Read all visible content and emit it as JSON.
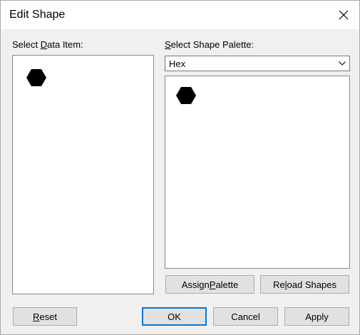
{
  "window": {
    "title": "Edit Shape",
    "close_icon": "close-icon"
  },
  "left_panel": {
    "label_prefix": "Select ",
    "label_mnemonic": "D",
    "label_suffix": "ata Item:",
    "items": [
      {
        "shape": "hexagon",
        "color": "#000000"
      }
    ]
  },
  "right_panel": {
    "label_mnemonic": "S",
    "label_rest": "elect Shape Palette:",
    "palette_select": {
      "value": "Hex"
    },
    "shapes": [
      {
        "shape": "hexagon",
        "color": "#000000"
      }
    ],
    "assign_palette": {
      "pre": "Assign ",
      "mnemonic": "P",
      "post": "alette"
    },
    "reload_shapes": {
      "pre": "Re",
      "mnemonic": "l",
      "post": "oad Shapes"
    }
  },
  "footer": {
    "reset": {
      "mnemonic": "R",
      "post": "eset"
    },
    "ok": "OK",
    "cancel": "Cancel",
    "apply": "Apply"
  },
  "colors": {
    "default_button_border": "#0078d7",
    "dialog_background": "#f0f0f0"
  }
}
